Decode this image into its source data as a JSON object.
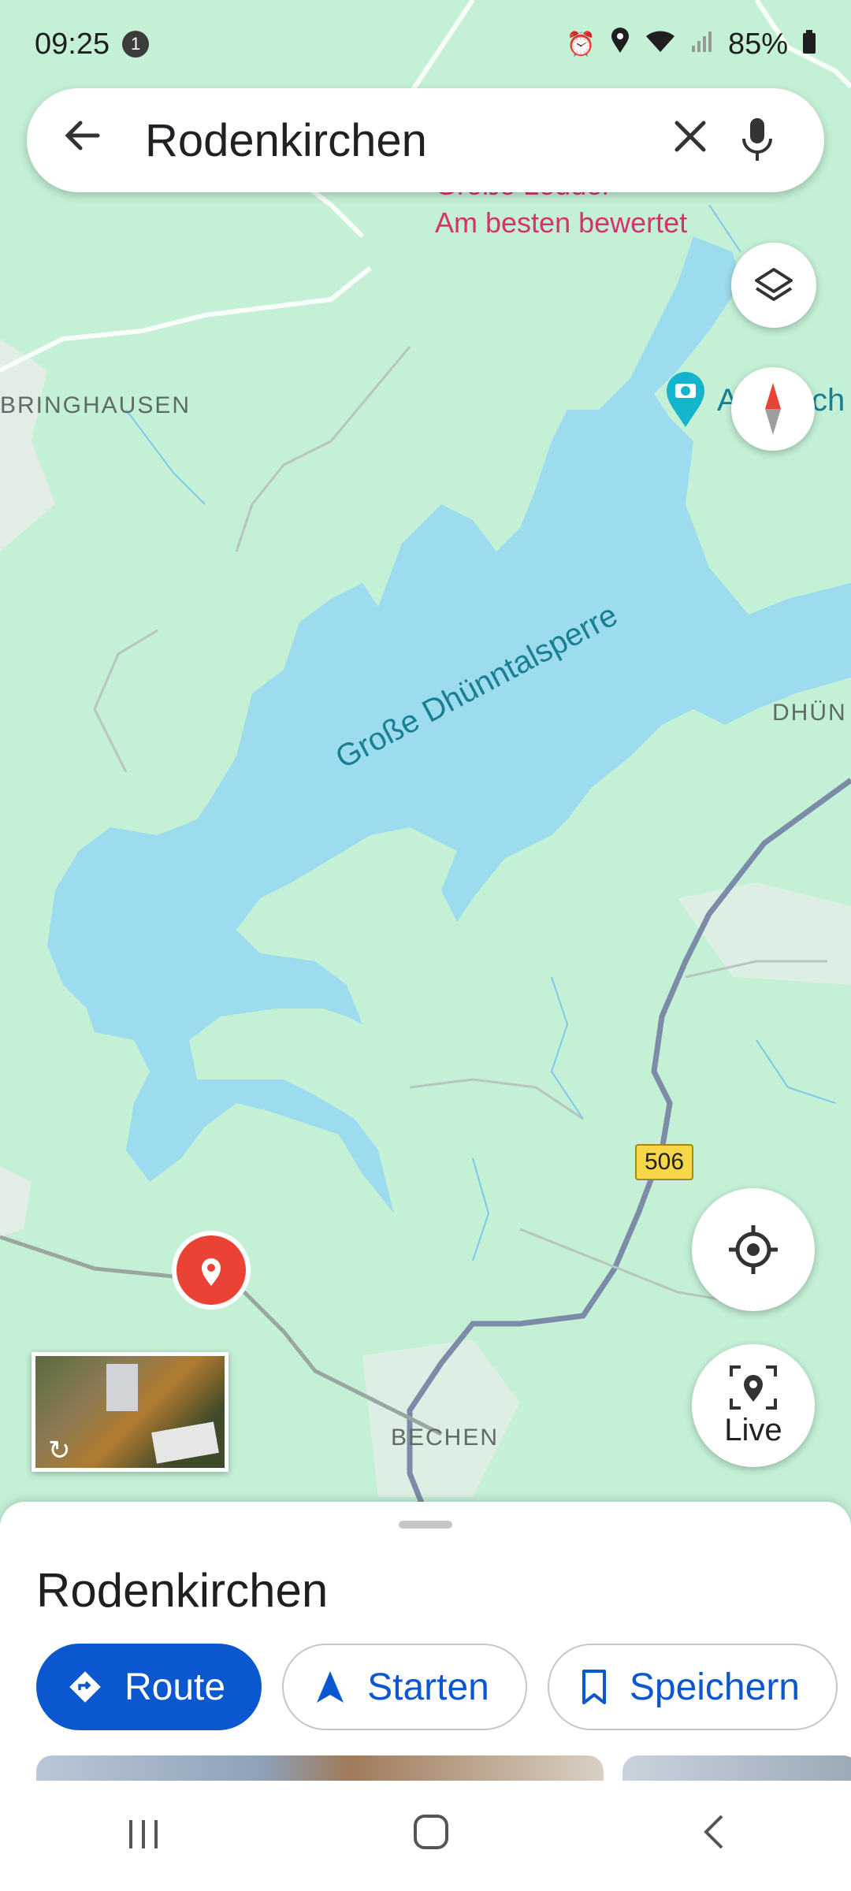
{
  "status_bar": {
    "time": "09:25",
    "notification_count": "1",
    "battery": "85%"
  },
  "search": {
    "query": "Rodenkirchen"
  },
  "map": {
    "poi": {
      "name": "Große Leuder",
      "tag": "Am besten bewertet"
    },
    "places": [
      "BRINGHAUSEN",
      "DHÜN",
      "BECHEN"
    ],
    "water": "Große Dhünntalsperre",
    "route_number": "506",
    "photo_poi_fragment": "A",
    "edge_fragment": "ch"
  },
  "controls": {
    "live_label": "Live"
  },
  "sheet": {
    "title": "Rodenkirchen",
    "buttons": {
      "route": "Route",
      "start": "Starten",
      "save": "Speichern"
    }
  },
  "colors": {
    "land": "#c4f0d6",
    "water": "#9ddcee",
    "primary": "#0b57d0",
    "poi": "#d6336c",
    "pin": "#ea4335"
  }
}
